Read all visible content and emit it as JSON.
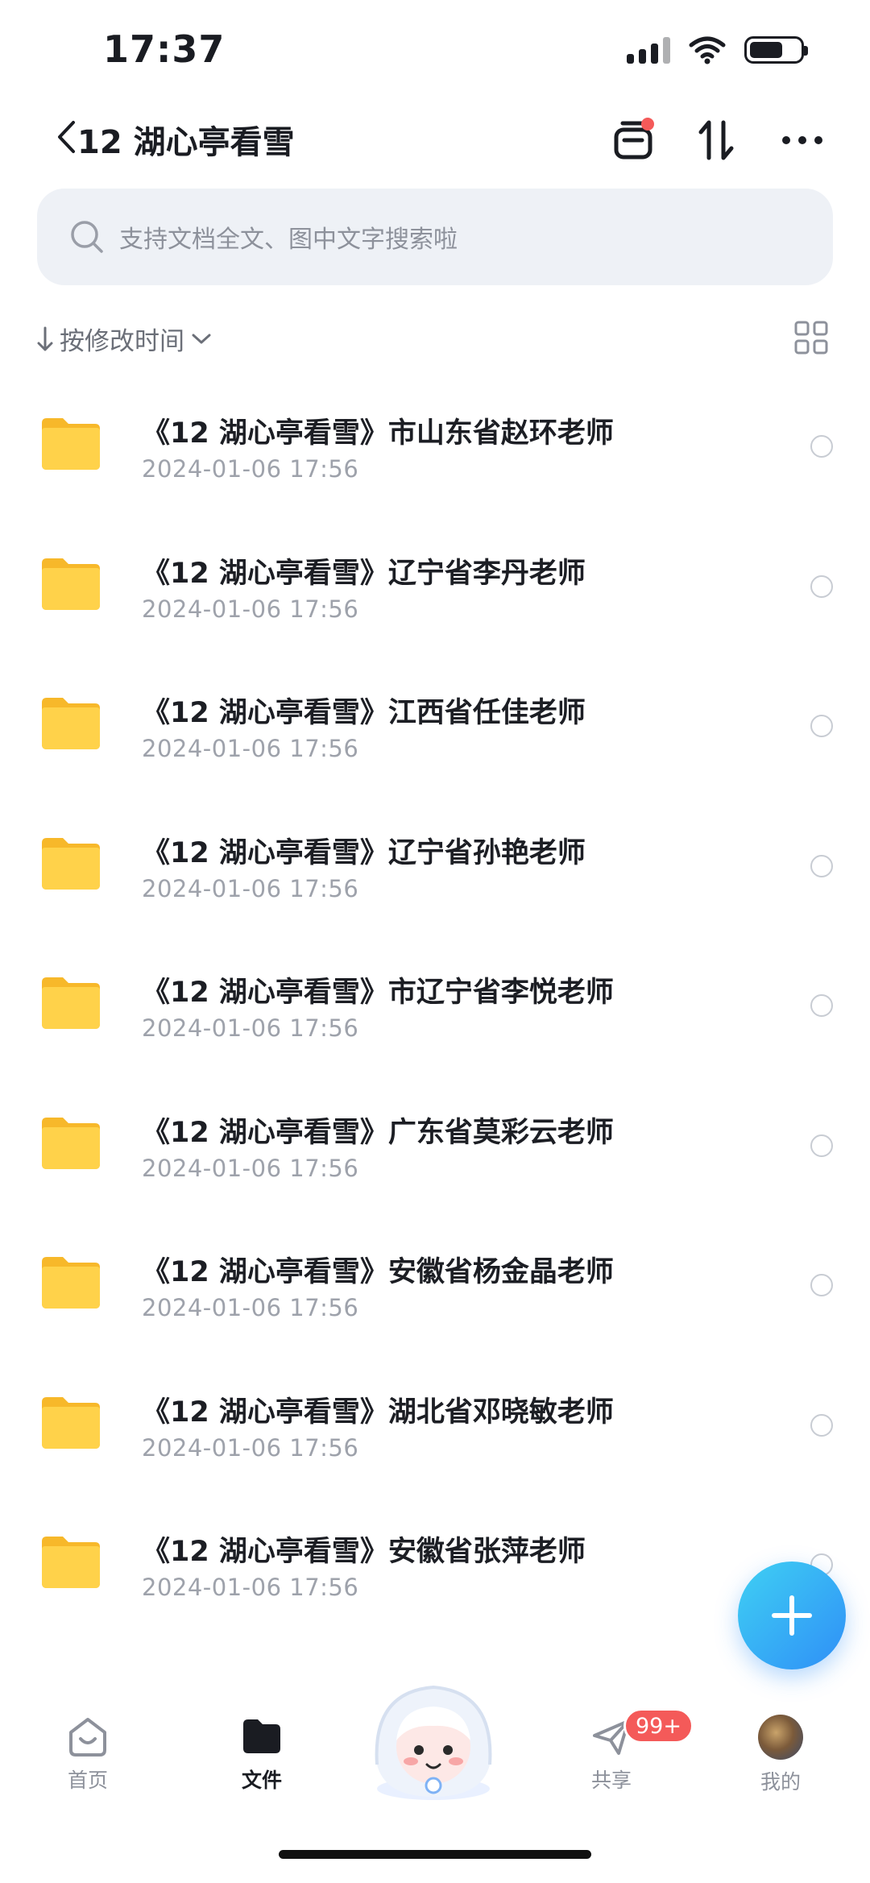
{
  "status_bar": {
    "time": "17:37"
  },
  "header": {
    "title": "12 湖心亭看雪"
  },
  "search": {
    "placeholder": "支持文档全文、图中文字搜索啦"
  },
  "sort": {
    "label": "按修改时间"
  },
  "files": [
    {
      "name": "《12 湖心亭看雪》市山东省赵环老师",
      "date": "2024-01-06 17:56"
    },
    {
      "name": "《12 湖心亭看雪》辽宁省李丹老师",
      "date": "2024-01-06 17:56"
    },
    {
      "name": "《12 湖心亭看雪》江西省任佳老师",
      "date": "2024-01-06 17:56"
    },
    {
      "name": "《12 湖心亭看雪》辽宁省孙艳老师",
      "date": "2024-01-06 17:56"
    },
    {
      "name": "《12 湖心亭看雪》市辽宁省李悦老师",
      "date": "2024-01-06 17:56"
    },
    {
      "name": "《12 湖心亭看雪》广东省莫彩云老师",
      "date": "2024-01-06 17:56"
    },
    {
      "name": "《12 湖心亭看雪》安徽省杨金晶老师",
      "date": "2024-01-06 17:56"
    },
    {
      "name": "《12 湖心亭看雪》湖北省邓晓敏老师",
      "date": "2024-01-06 17:56"
    },
    {
      "name": "《12 湖心亭看雪》安徽省张萍老师",
      "date": "2024-01-06 17:56"
    }
  ],
  "nav": {
    "home": "首页",
    "files": "文件",
    "share": "共享",
    "share_badge": "99+",
    "mine": "我的"
  },
  "colors": {
    "accent": "#2f8ff7",
    "badge": "#f45a59",
    "folder": "#ffc93a"
  }
}
